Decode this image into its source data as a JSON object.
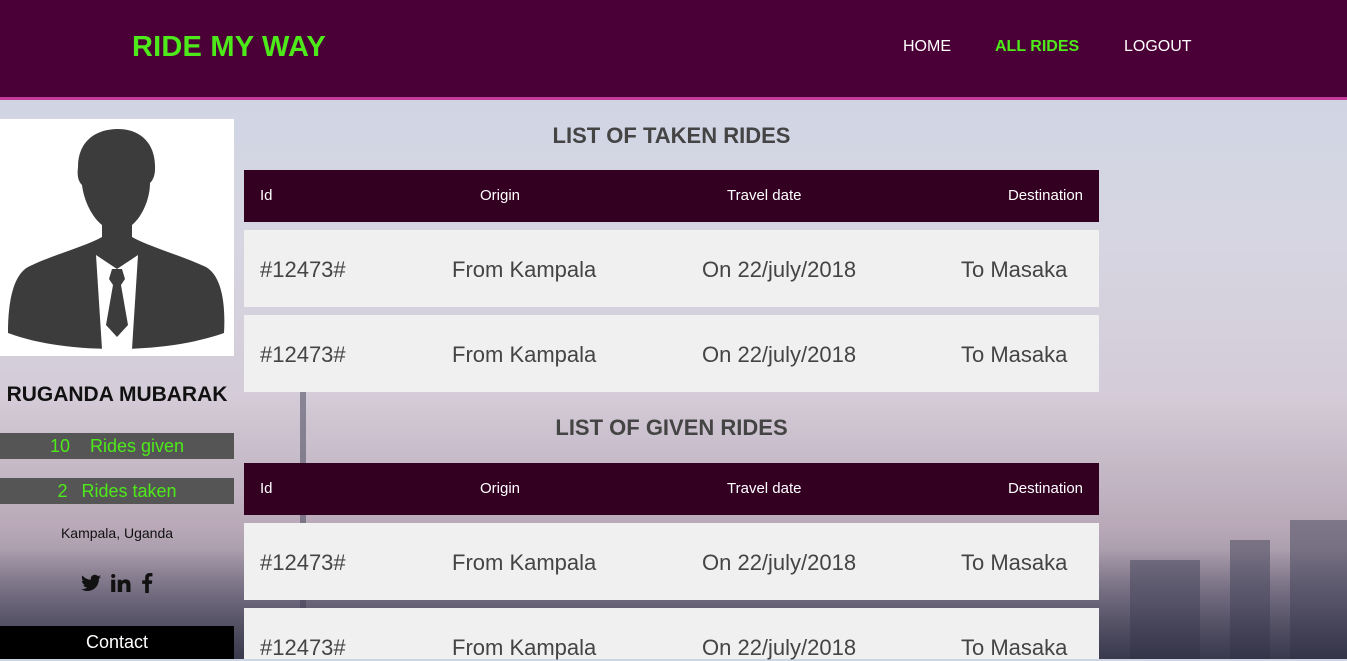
{
  "header": {
    "brand": "RIDE MY WAY",
    "nav": [
      {
        "label": "HOME"
      },
      {
        "label": "ALL RIDES",
        "active": true
      },
      {
        "label": "LOGOUT"
      }
    ]
  },
  "profile": {
    "name": "RUGANDA MUBARAK",
    "rides_given_count": "10",
    "rides_given_label": "Rides given",
    "rides_taken_count": "2",
    "rides_taken_label": "Rides taken",
    "location": "Kampala, Uganda",
    "social_icons": [
      "twitter-icon",
      "linkedin-icon",
      "facebook-icon"
    ],
    "contact_label": "Contact"
  },
  "taken": {
    "title": "LIST OF TAKEN RIDES",
    "columns": [
      "Id",
      "Origin",
      "Travel date",
      "Destination"
    ],
    "rows": [
      {
        "id": "#12473#",
        "origin": "From Kampala",
        "date": "On 22/july/2018",
        "dest": "To Masaka"
      },
      {
        "id": "#12473#",
        "origin": "From Kampala",
        "date": "On 22/july/2018",
        "dest": "To Masaka"
      }
    ]
  },
  "given": {
    "title": "LIST OF GIVEN RIDES",
    "columns": [
      "Id",
      "Origin",
      "Travel date",
      "Destination"
    ],
    "rows": [
      {
        "id": "#12473#",
        "origin": "From Kampala",
        "date": "On 22/july/2018",
        "dest": "To Masaka"
      },
      {
        "id": "#12473#",
        "origin": "From Kampala",
        "date": "On 22/july/2018",
        "dest": "To Masaka"
      }
    ]
  },
  "colors": {
    "header_bg": "#4a0037",
    "accent_green": "#4ee91a",
    "table_header_bg": "#330022",
    "row_bg": "#f0f0f0"
  }
}
